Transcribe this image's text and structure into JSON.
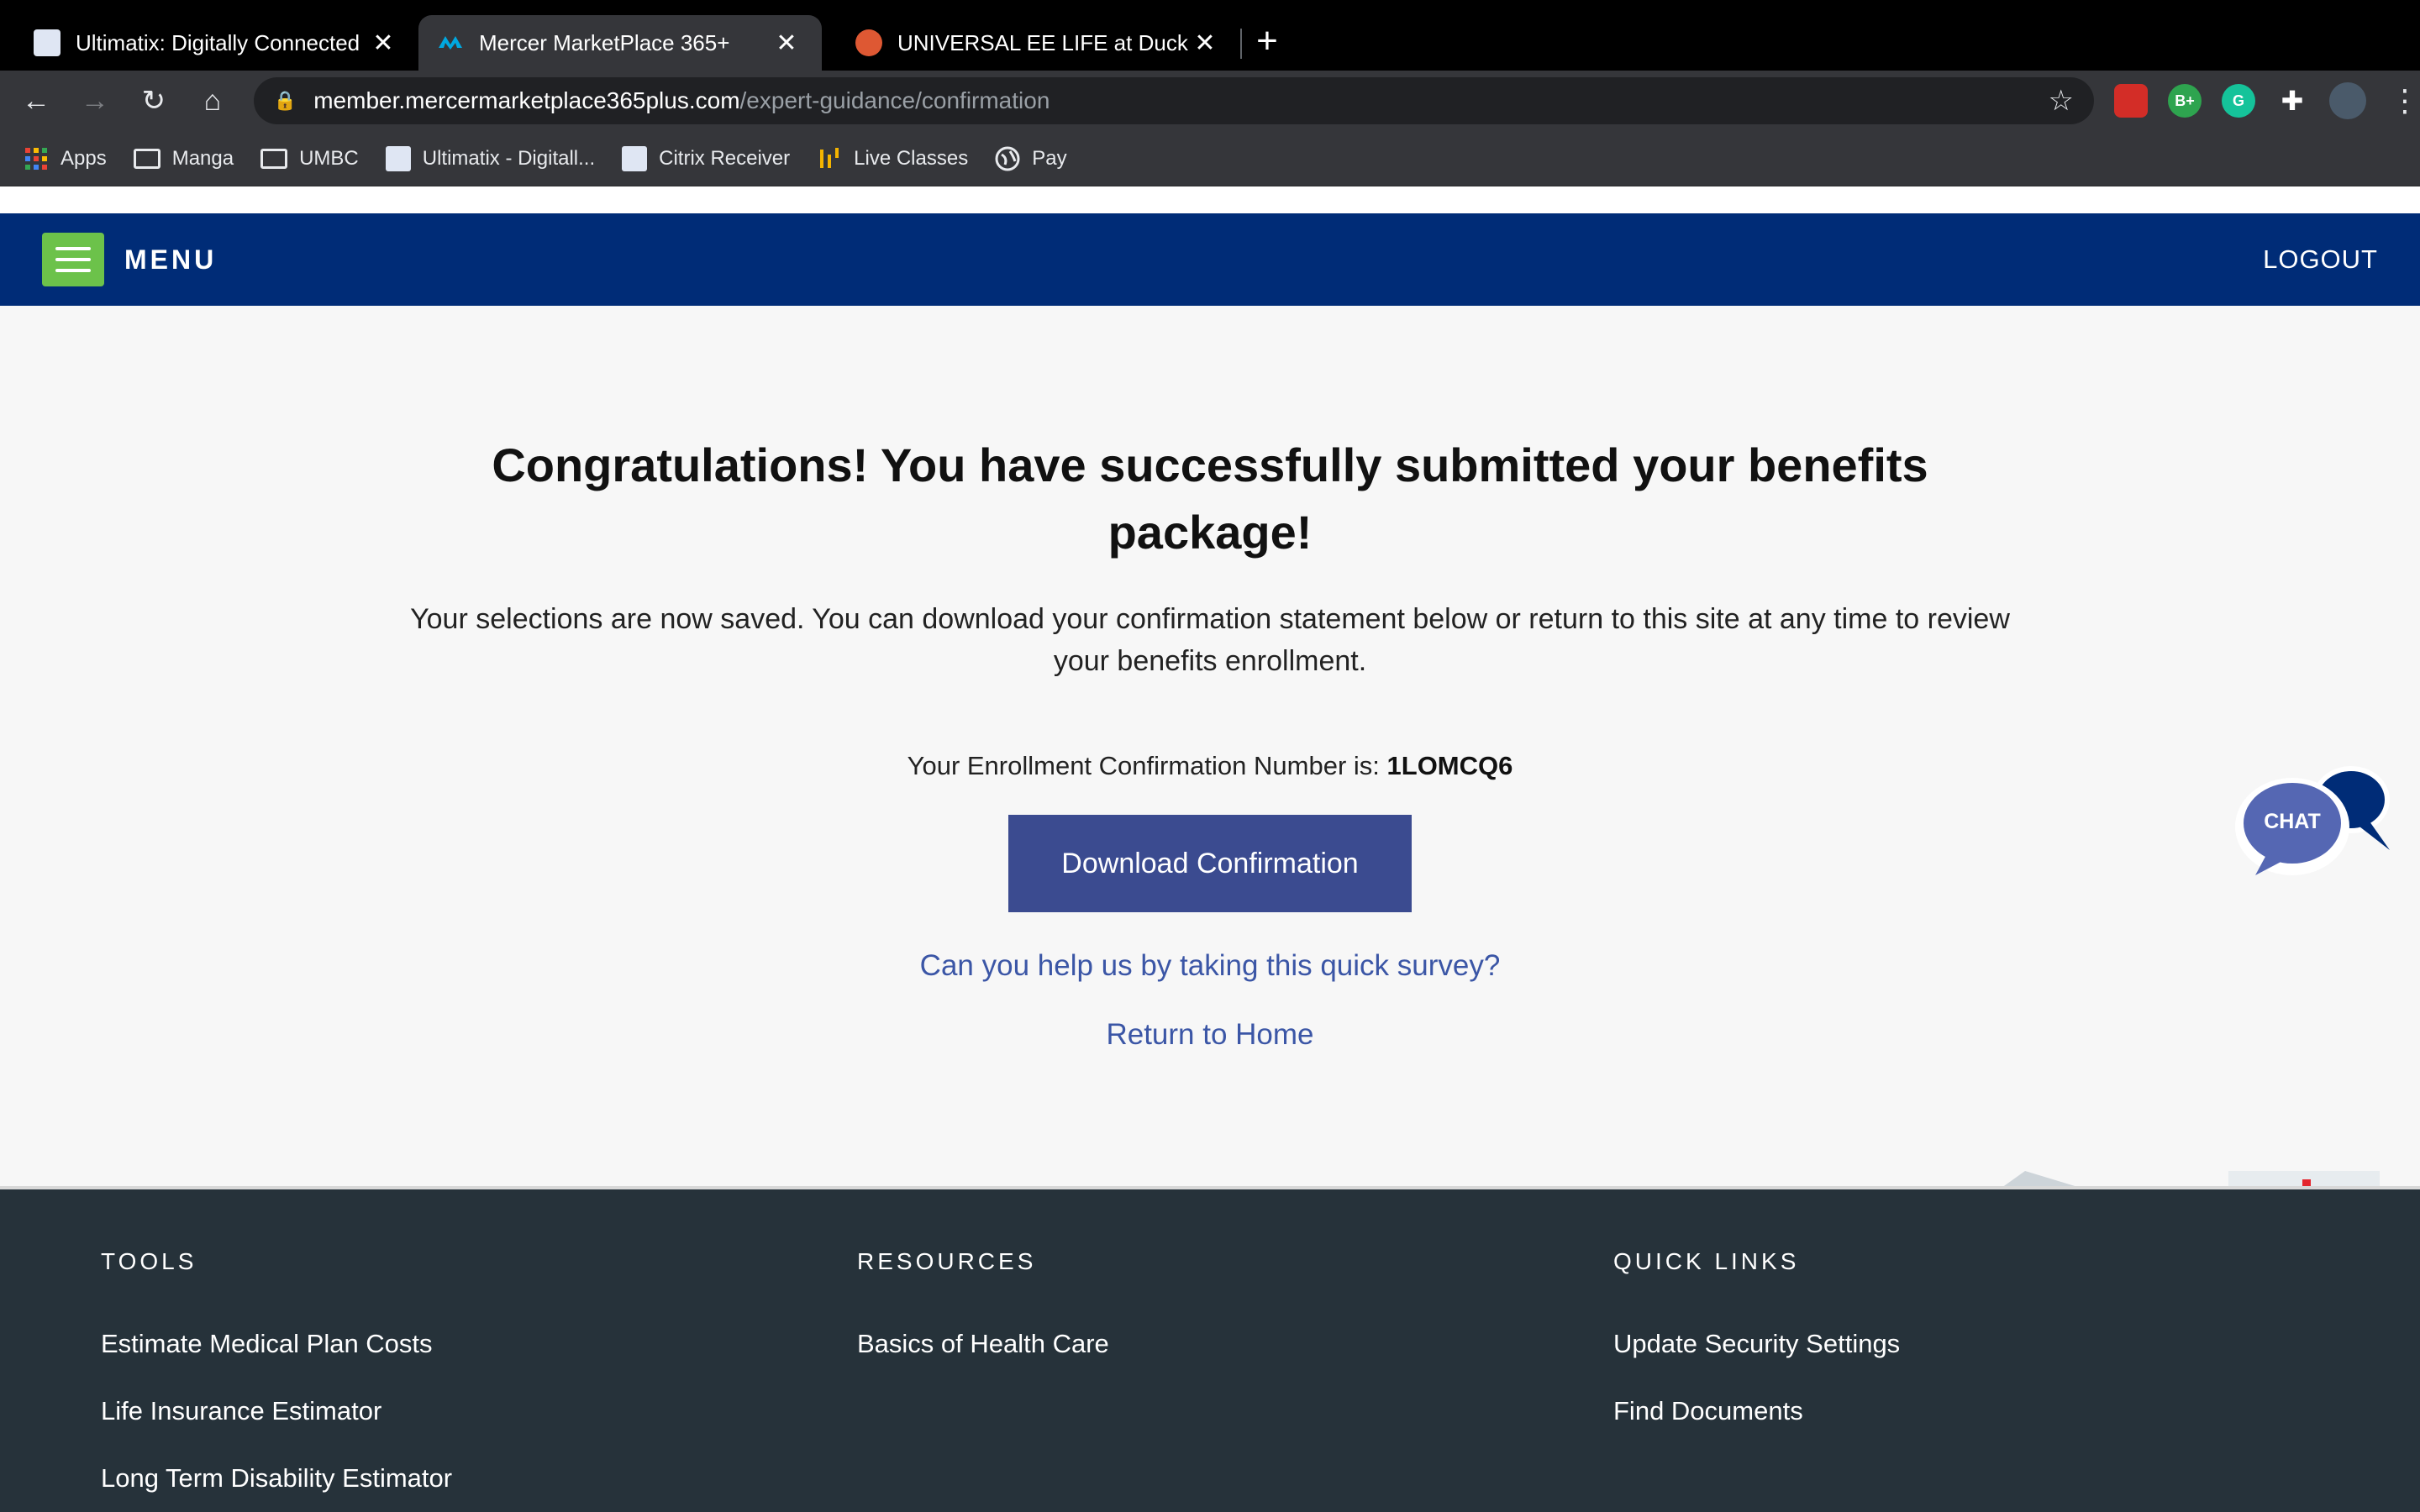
{
  "browser": {
    "tabs": [
      {
        "title": "Ultimatix: Digitally Connected",
        "active": false
      },
      {
        "title": "Mercer MarketPlace 365+",
        "active": true
      },
      {
        "title": "UNIVERSAL EE LIFE at DuckDu",
        "active": false
      }
    ],
    "url_host": "member.mercermarketplace365plus.com",
    "url_path": "/expert-guidance/confirmation",
    "bookmarks": [
      "Apps",
      "Manga",
      "UMBC",
      "Ultimatix - Digitall...",
      "Citrix Receiver",
      "Live Classes",
      "Pay"
    ],
    "extensions": {
      "b_plus": "B+",
      "grammarly": "G"
    }
  },
  "nav": {
    "menu_label": "MENU",
    "logout_label": "LOGOUT"
  },
  "main": {
    "headline": "Congratulations! You have successfully submitted your benefits package!",
    "subtext": "Your selections are now saved. You can download your confirmation statement below or return to this site at any time to review your benefits enrollment.",
    "confirmation_label": "Your Enrollment Confirmation Number is:",
    "confirmation_number": "1LOMCQ6",
    "download_label": "Download Confirmation",
    "survey_link": "Can you help us by taking this quick survey?",
    "home_link": "Return to Home",
    "chat_label": "CHAT"
  },
  "footer": {
    "tools_heading": "TOOLS",
    "tools": [
      "Estimate Medical Plan Costs",
      "Life Insurance Estimator",
      "Long Term Disability Estimator"
    ],
    "resources_heading": "RESOURCES",
    "resources": [
      "Basics of Health Care"
    ],
    "quick_heading": "QUICK LINKS",
    "quick": [
      "Update Security Settings",
      "Find Documents"
    ]
  },
  "colors": {
    "nav_blue": "#002c77",
    "menu_green": "#6cc24a",
    "button_blue": "#3b4b90",
    "link_blue": "#3b56a6",
    "footer_bg": "#26323a"
  }
}
